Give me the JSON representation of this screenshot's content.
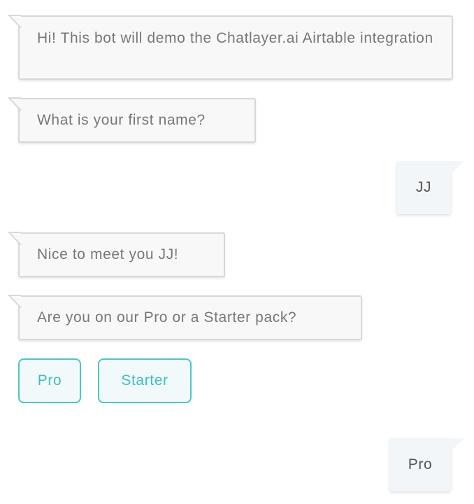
{
  "messages": {
    "bot_intro": "Hi! This bot will demo the Chatlayer.ai Airtable integration",
    "bot_ask_name": "What is your first name?",
    "user_name": "JJ",
    "bot_greet": "Nice to meet you JJ!",
    "bot_ask_plan": "Are you on our Pro or a Starter pack?",
    "user_plan": "Pro"
  },
  "quick_replies": {
    "pro": "Pro",
    "starter": "Starter"
  },
  "colors": {
    "bot_bubble_bg": "#f8f8f8",
    "bot_bubble_border": "#d8d8d8",
    "bot_text": "#777777",
    "user_bubble_bg": "#f3f6f9",
    "user_text": "#555555",
    "accent": "#4cc7c5"
  }
}
